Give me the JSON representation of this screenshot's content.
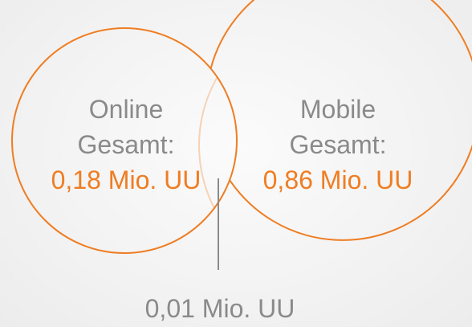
{
  "colors": {
    "accent": "#ef7d22",
    "text": "#8a8a8a",
    "leader_line": "#8a8a8a",
    "overlap_tint": "#f6d2b8"
  },
  "online": {
    "title_line1": "Online",
    "title_line2": "Gesamt:",
    "value": "0,18 Mio. UU"
  },
  "mobile": {
    "title_line1": "Mobile",
    "title_line2": "Gesamt:",
    "value": "0,86 Mio. UU"
  },
  "overlap": {
    "value": "0,01 Mio. UU"
  }
}
